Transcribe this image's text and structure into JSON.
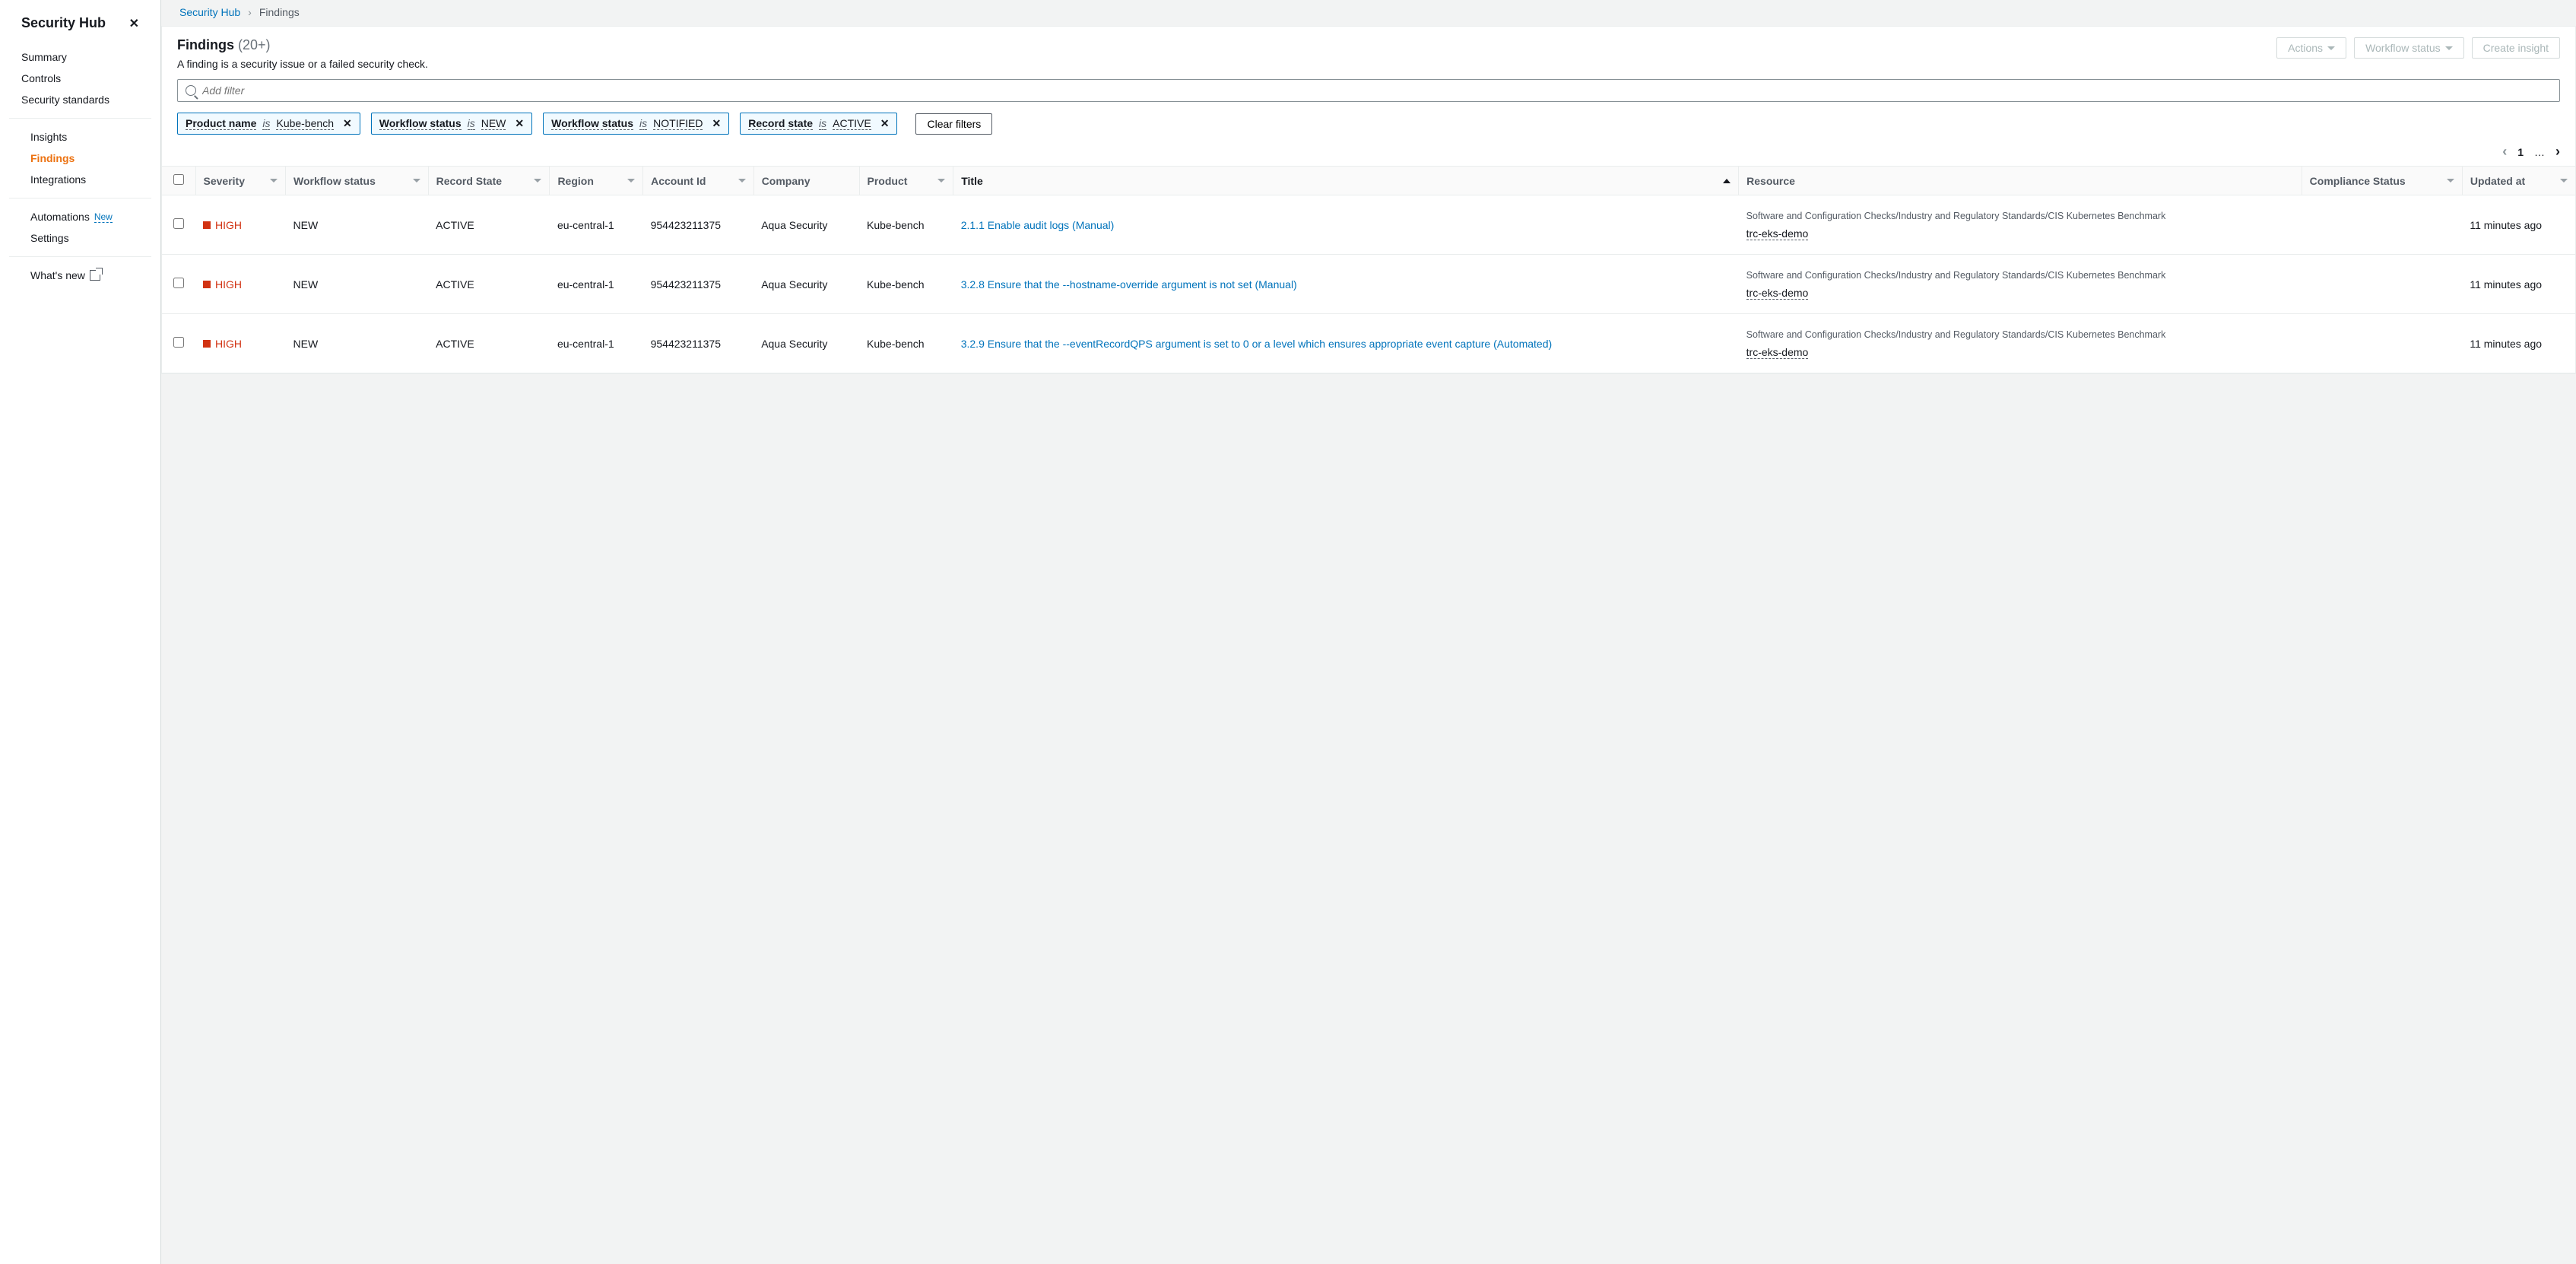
{
  "sidebar": {
    "title": "Security Hub",
    "groups": [
      {
        "items": [
          {
            "label": "Summary"
          },
          {
            "label": "Controls"
          },
          {
            "label": "Security standards"
          }
        ]
      },
      {
        "items": [
          {
            "label": "Insights"
          },
          {
            "label": "Findings",
            "active": true
          },
          {
            "label": "Integrations"
          }
        ]
      },
      {
        "items": [
          {
            "label": "Automations",
            "badge": "New"
          },
          {
            "label": "Settings"
          }
        ]
      },
      {
        "items": [
          {
            "label": "What's new",
            "external": true
          }
        ]
      }
    ]
  },
  "breadcrumb": {
    "root": "Security Hub",
    "current": "Findings"
  },
  "header": {
    "title": "Findings",
    "count": "(20+)",
    "subtitle": "A finding is a security issue or a failed security check.",
    "actions_label": "Actions",
    "workflow_label": "Workflow status",
    "create_label": "Create insight"
  },
  "filter": {
    "placeholder": "Add filter",
    "chips": [
      {
        "field": "Product name",
        "op": "is",
        "value": "Kube-bench"
      },
      {
        "field": "Workflow status",
        "op": "is",
        "value": "NEW"
      },
      {
        "field": "Workflow status",
        "op": "is",
        "value": "NOTIFIED"
      },
      {
        "field": "Record state",
        "op": "is",
        "value": "ACTIVE"
      }
    ],
    "clear_label": "Clear filters"
  },
  "pager": {
    "page": "1",
    "ellipsis": "…"
  },
  "columns": {
    "severity": "Severity",
    "workflow": "Workflow status",
    "record": "Record State",
    "region": "Region",
    "account": "Account Id",
    "company": "Company",
    "product": "Product",
    "title": "Title",
    "resource": "Resource",
    "compliance": "Compliance Status",
    "updated": "Updated at"
  },
  "resource_text": "Software and Configuration Checks/Industry and Regulatory Standards/CIS Kubernetes Benchmark",
  "rows": [
    {
      "severity": "HIGH",
      "workflow": "NEW",
      "record": "ACTIVE",
      "region": "eu-central-1",
      "account": "954423211375",
      "company": "Aqua Security",
      "product": "Kube-bench",
      "title": "2.1.1 Enable audit logs (Manual)",
      "resource_link": "trc-eks-demo",
      "updated": "11 minutes ago"
    },
    {
      "severity": "HIGH",
      "workflow": "NEW",
      "record": "ACTIVE",
      "region": "eu-central-1",
      "account": "954423211375",
      "company": "Aqua Security",
      "product": "Kube-bench",
      "title": "3.2.8 Ensure that the --hostname-override argument is not set (Manual)",
      "resource_link": "trc-eks-demo",
      "updated": "11 minutes ago"
    },
    {
      "severity": "HIGH",
      "workflow": "NEW",
      "record": "ACTIVE",
      "region": "eu-central-1",
      "account": "954423211375",
      "company": "Aqua Security",
      "product": "Kube-bench",
      "title": "3.2.9 Ensure that the --eventRecordQPS argument is set to 0 or a level which ensures appropriate event capture (Automated)",
      "resource_link": "trc-eks-demo",
      "updated": "11 minutes ago"
    }
  ]
}
